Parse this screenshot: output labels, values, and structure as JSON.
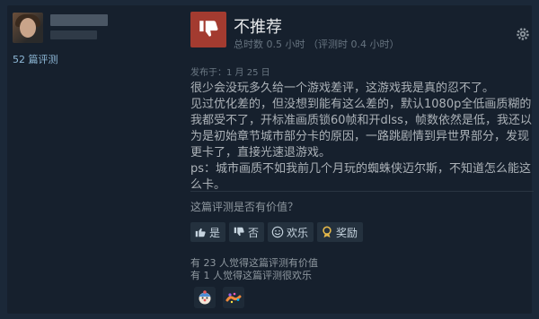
{
  "reviewer": {
    "review_count": "52 篇评测"
  },
  "review": {
    "verdict": "不推荐",
    "hours": "总时数 0.5 小时  （评测时 0.4 小时）",
    "posted": "发布于：1 月 25 日",
    "paragraphs": [
      "很少会没玩多久给一个游戏差评，这游戏我是真的忍不了。",
      "见过优化差的，但没想到能有这么差的，默认1080p全低画质糊的我都受不了，开标准画质锁60帧和开dlss，帧数依然是低，我还以为是初始章节城市部分卡的原因，一路跳剧情到异世界部分，发现更卡了，直接光速退游戏。",
      "ps：城市画质不如我前几个月玩的蜘蛛侠迈尔斯，不知道怎么能这么卡。"
    ]
  },
  "feedback": {
    "question": "这篇评测是否有价值？",
    "buttons": {
      "yes": "是",
      "no": "否",
      "funny": "欢乐",
      "award": "奖励"
    },
    "stat_helpful": "有 23 人觉得这篇评测有价值",
    "stat_funny": "有 1 人觉得这篇评测很欢乐"
  },
  "colors": {
    "thumb_down_bg": "#a33b30",
    "background": "#1b2838",
    "card": "#16202d",
    "link": "#8fb9d8"
  }
}
